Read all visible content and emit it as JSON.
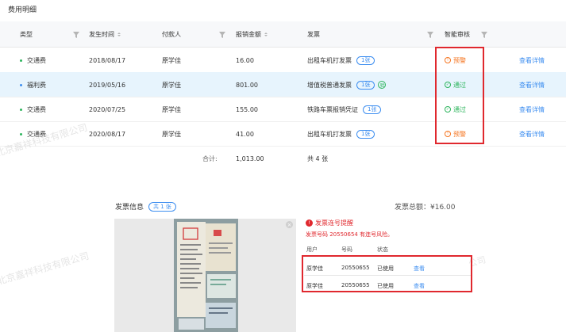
{
  "section_title": "费用明细",
  "columns": {
    "type": "类型",
    "date": "发生时间",
    "payer": "付款人",
    "amount": "报销金额",
    "invoice": "发票",
    "audit": "智能审核"
  },
  "rows": [
    {
      "type": "交通费",
      "dot_color": "#2db55d",
      "date": "2018/08/17",
      "payer": "原学佳",
      "amount": "16.00",
      "invoice": "出租车机打发票",
      "invoice_count": "1张",
      "verified": false,
      "audit": "预警",
      "audit_kind": "warn",
      "action": "查看详情",
      "selected": false
    },
    {
      "type": "福利费",
      "dot_color": "#3d8ef0",
      "date": "2019/05/16",
      "payer": "原学佳",
      "amount": "801.00",
      "invoice": "增值税普通发票",
      "invoice_count": "1张",
      "verified": true,
      "verified_mark": "验",
      "audit": "通过",
      "audit_kind": "pass",
      "action": "查看详情",
      "selected": true
    },
    {
      "type": "交通费",
      "dot_color": "#2db55d",
      "date": "2020/07/25",
      "payer": "原学佳",
      "amount": "155.00",
      "invoice": "铁路车票报销凭证",
      "invoice_count": "1张",
      "verified": false,
      "audit": "通过",
      "audit_kind": "pass",
      "action": "查看详情",
      "selected": false
    },
    {
      "type": "交通费",
      "dot_color": "#2db55d",
      "date": "2020/08/17",
      "payer": "原学佳",
      "amount": "41.00",
      "invoice": "出租车机打发票",
      "invoice_count": "1张",
      "verified": false,
      "audit": "预警",
      "audit_kind": "warn",
      "action": "查看详情",
      "selected": false
    }
  ],
  "summary": {
    "label": "合计:",
    "amount": "1,013.00",
    "count": "共 4 张"
  },
  "invoice_info": {
    "title": "发票信息",
    "count_pill": "共 1 张",
    "total": "发票总额：¥16.00"
  },
  "alert": {
    "title": "发票连号提醒",
    "message": "发票号码 20550654 有连号风险。"
  },
  "mini_table": {
    "headers": [
      "用户",
      "号码",
      "状态"
    ],
    "rows": [
      {
        "user": "原学佳",
        "number": "20550655",
        "status": "已使用",
        "action": "查看"
      },
      {
        "user": "原学佳",
        "number": "20550655",
        "status": "已使用",
        "action": "查看"
      }
    ]
  },
  "watermarks": [
    "北京嘉祥科技有限公司",
    "北京嘉祥科技有限公司",
    "公司"
  ],
  "colors": {
    "accent": "#3d8ef0",
    "warn": "#f5741f",
    "pass": "#2db55d",
    "highlight_box": "#e0282e",
    "selected_row": "#e7f4fd"
  },
  "icons": {
    "filter": "filter-icon",
    "sort": "sort-icon",
    "warn": "clock-warning-icon",
    "pass": "check-circle-icon",
    "alert": "exclamation-icon",
    "close": "close-icon"
  }
}
